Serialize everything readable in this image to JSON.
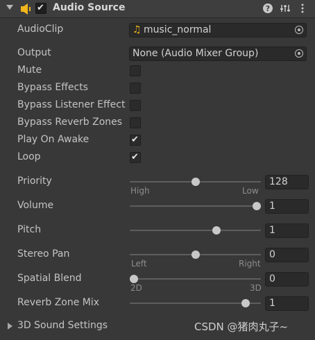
{
  "header": {
    "title": "Audio Source",
    "enabled": true,
    "icons": [
      "foldout-arrow-icon",
      "audio-source-speaker-icon",
      "help-icon",
      "presets-icon",
      "context-menu-icon"
    ]
  },
  "properties": {
    "audio_clip": {
      "label": "AudioClip",
      "value": "music_normal"
    },
    "output": {
      "label": "Output",
      "value": "None (Audio Mixer Group)"
    },
    "mute": {
      "label": "Mute",
      "checked": false
    },
    "bypass_effects": {
      "label": "Bypass Effects",
      "checked": false
    },
    "bypass_listener_effects": {
      "label": "Bypass Listener Effect",
      "checked": false
    },
    "bypass_reverb_zones": {
      "label": "Bypass Reverb Zones",
      "checked": false
    },
    "play_on_awake": {
      "label": "Play On Awake",
      "checked": true
    },
    "loop": {
      "label": "Loop",
      "checked": true
    },
    "priority": {
      "label": "Priority",
      "value": "128",
      "min_label": "High",
      "max_label": "Low",
      "fraction": 0.5
    },
    "volume": {
      "label": "Volume",
      "value": "1",
      "fraction": 1.0
    },
    "pitch": {
      "label": "Pitch",
      "value": "1",
      "fraction": 0.67
    },
    "stereo_pan": {
      "label": "Stereo Pan",
      "value": "0",
      "min_label": "Left",
      "max_label": "Right",
      "fraction": 0.5
    },
    "spatial_blend": {
      "label": "Spatial Blend",
      "value": "0",
      "min_label": "2D",
      "max_label": "3D",
      "fraction": 0.0
    },
    "reverb_zone_mix": {
      "label": "Reverb Zone Mix",
      "value": "1",
      "fraction": 0.91
    }
  },
  "sections": {
    "sound_3d": {
      "label": "3D Sound Settings",
      "expanded": false
    }
  },
  "watermark": "CSDN @猪肉丸子~",
  "colors": {
    "slider_thumb": "#c8c8c8",
    "accent_icon": "#f1b51c"
  }
}
